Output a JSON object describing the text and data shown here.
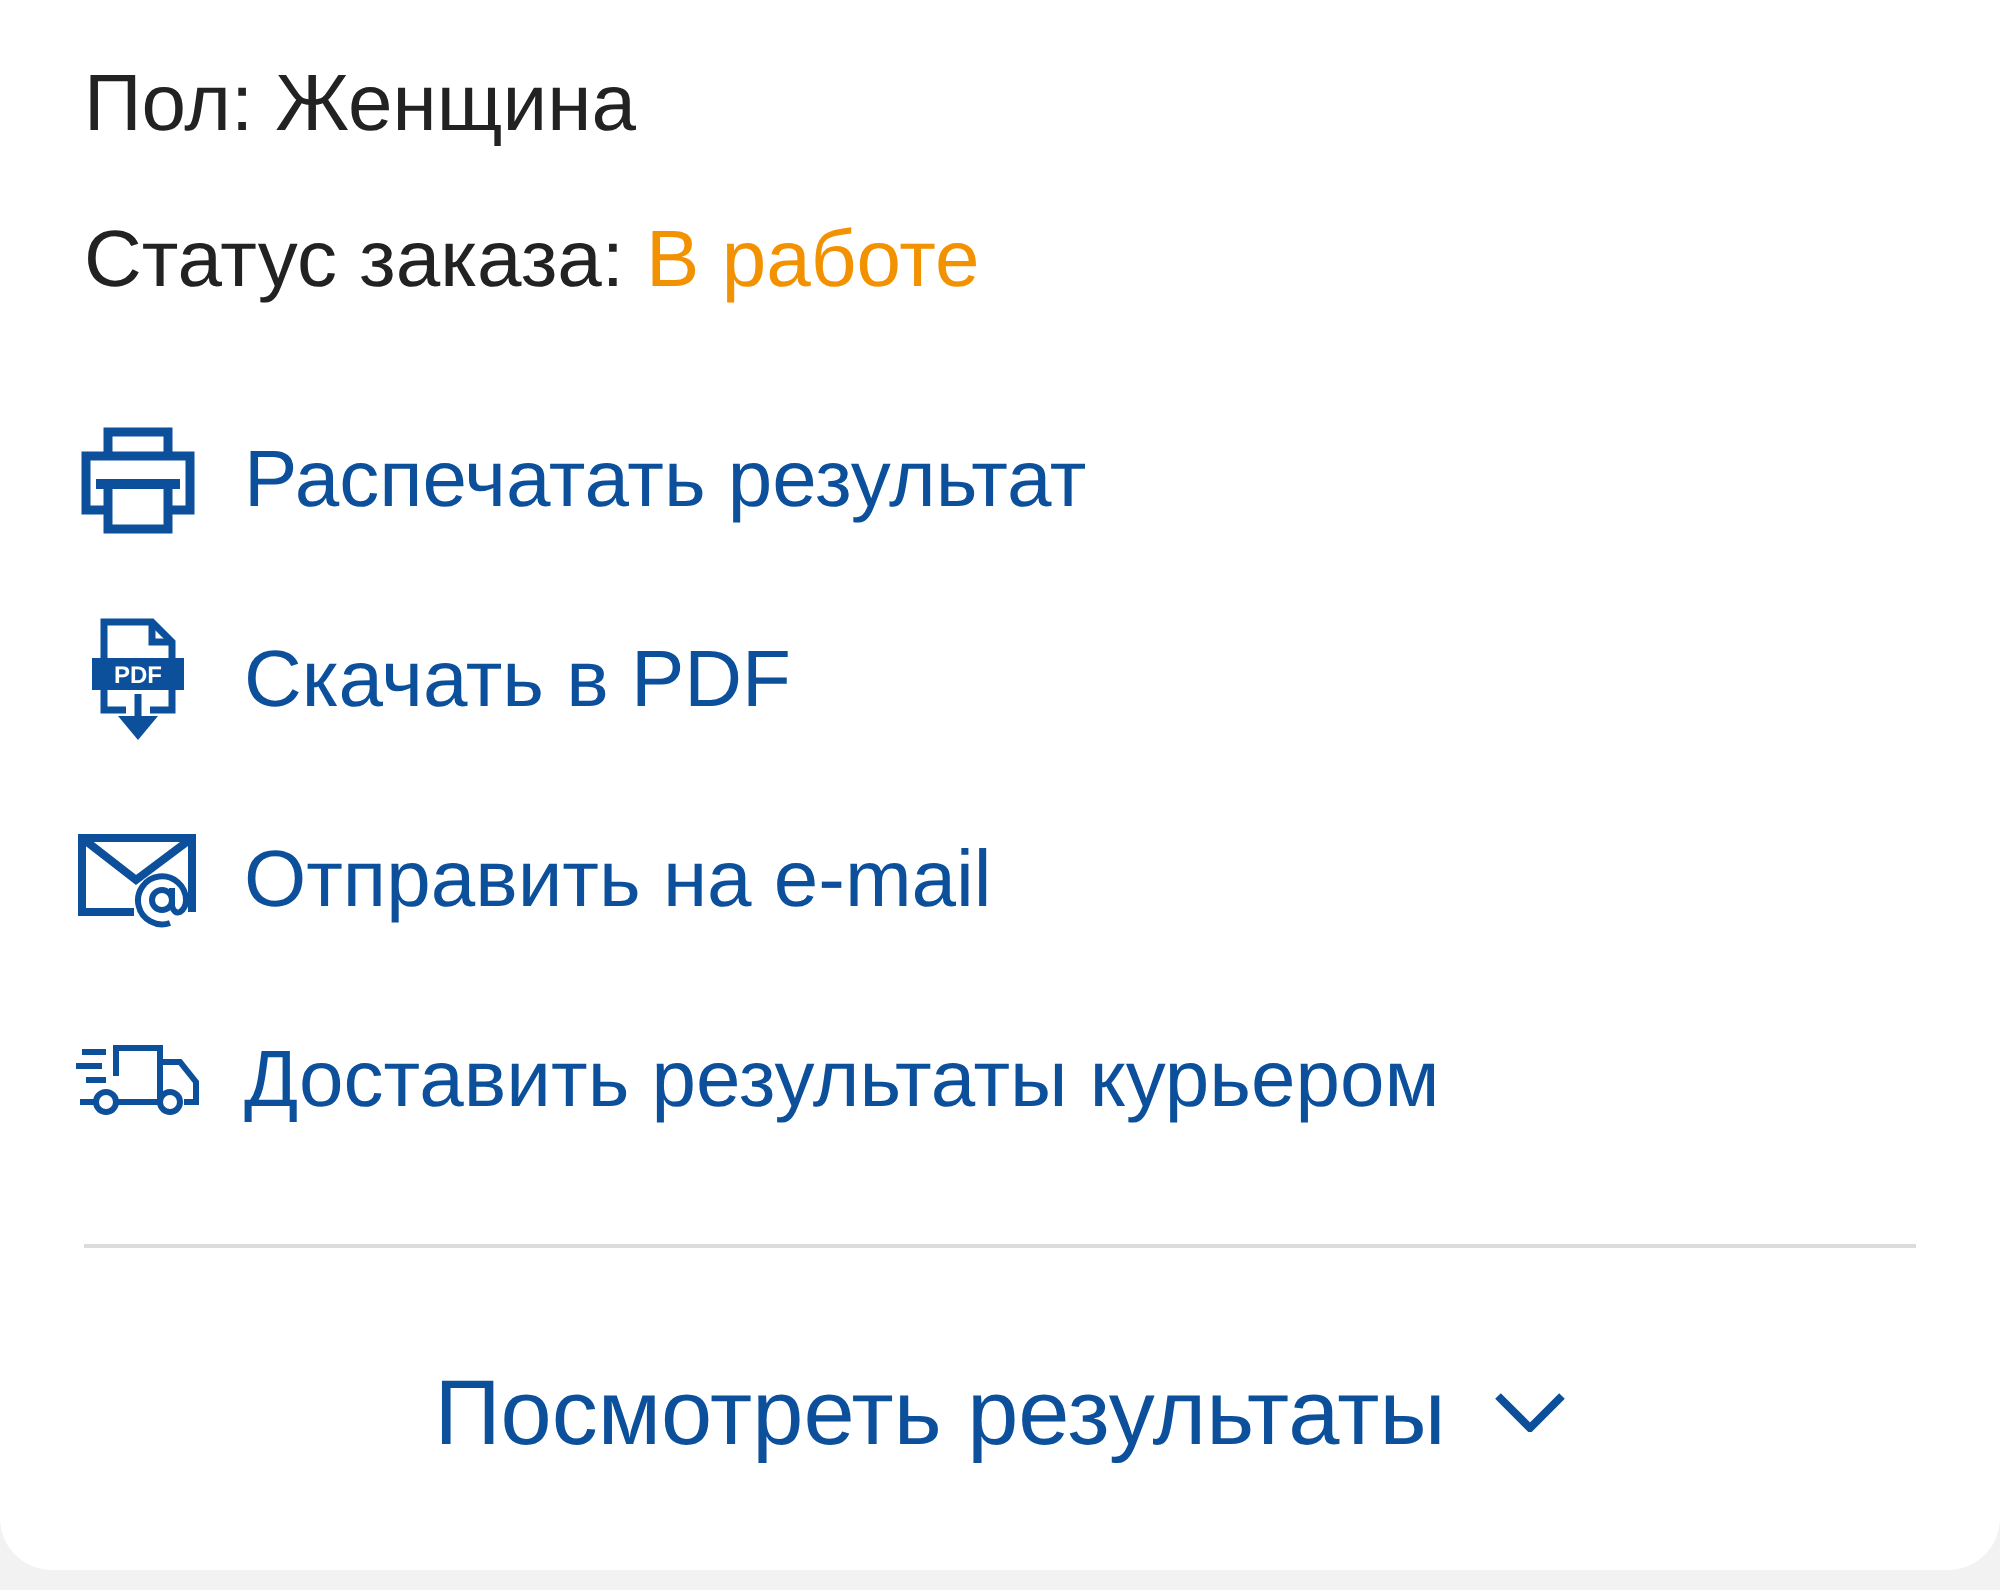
{
  "info": [
    {
      "kind": "plain",
      "label": "Пол:",
      "value": "Женщина"
    },
    {
      "kind": "status",
      "label": "Статус заказа:",
      "value": "В работе"
    }
  ],
  "actions": [
    {
      "kind": "print",
      "label": "Распечатать результат"
    },
    {
      "kind": "pdf",
      "label": "Скачать в PDF",
      "icon_text": "PDF"
    },
    {
      "kind": "email",
      "label": "Отправить на e-mail"
    },
    {
      "kind": "courier",
      "label": "Доставить результаты курьером"
    }
  ],
  "results_toggle": {
    "label": "Посмотреть результаты",
    "expanded": false
  }
}
